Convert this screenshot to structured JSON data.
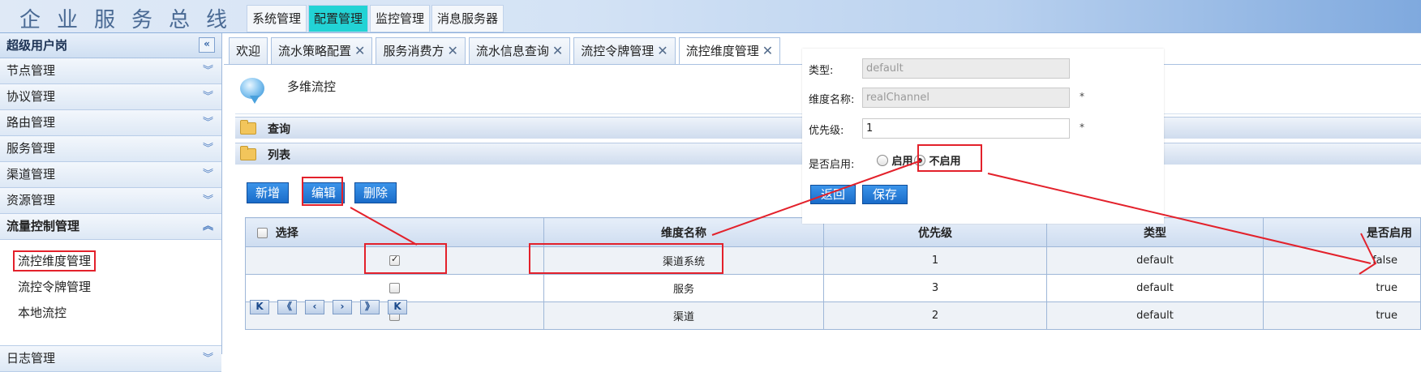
{
  "header": {
    "app_title": "企业服务总线",
    "nav": [
      "系统管理",
      "配置管理",
      "监控管理",
      "消息服务器"
    ],
    "active_nav": 1
  },
  "sidebar": {
    "title": "超级用户岗",
    "collapse_glyph": "«",
    "items": [
      "节点管理",
      "协议管理",
      "路由管理",
      "服务管理",
      "渠道管理",
      "资源管理"
    ],
    "open_group": "流量控制管理",
    "sub_items": [
      "流控维度管理",
      "流控令牌管理",
      "本地流控"
    ],
    "current_sub": 0,
    "next_group": "日志管理"
  },
  "tabs": [
    {
      "label": "欢迎",
      "closable": false
    },
    {
      "label": "流水策略配置",
      "closable": true
    },
    {
      "label": "服务消费方",
      "closable": true
    },
    {
      "label": "流水信息查询",
      "closable": true
    },
    {
      "label": "流控令牌管理",
      "closable": true
    },
    {
      "label": "流控维度管理",
      "closable": true,
      "active": true
    }
  ],
  "page": {
    "title": "多维流控",
    "query_panel": "查询",
    "list_panel": "列表",
    "buttons": {
      "add": "新增",
      "edit": "编辑",
      "delete": "删除"
    }
  },
  "table": {
    "headers": {
      "select": "选择",
      "dimension_name": "维度名称",
      "priority": "优先级",
      "type": "类型",
      "enabled": "是否启用"
    },
    "rows": [
      {
        "checked": true,
        "dimension_name": "渠道系统",
        "priority": "1",
        "type": "default",
        "enabled": "false"
      },
      {
        "checked": false,
        "dimension_name": "服务",
        "priority": "3",
        "type": "default",
        "enabled": "true"
      },
      {
        "checked": false,
        "dimension_name": "渠道",
        "priority": "2",
        "type": "default",
        "enabled": "true"
      }
    ]
  },
  "pager": [
    "K",
    "《",
    "‹",
    "›",
    "》",
    "K"
  ],
  "dialog": {
    "type_label": "类型:",
    "type_value": "default",
    "dim_label": "维度名称:",
    "dim_value": "realChannel",
    "priority_label": "优先级:",
    "priority_value": "1",
    "required_mark": "*",
    "enabled_label": "是否启用:",
    "enable_option": "启用",
    "disable_option": "不启用",
    "selected_option": "不启用",
    "back_button": "返回",
    "save_button": "保存"
  },
  "colors": {
    "accent_tab": "#22d3d5",
    "highlight": "#e3212b",
    "button": "#1a6cc9"
  }
}
